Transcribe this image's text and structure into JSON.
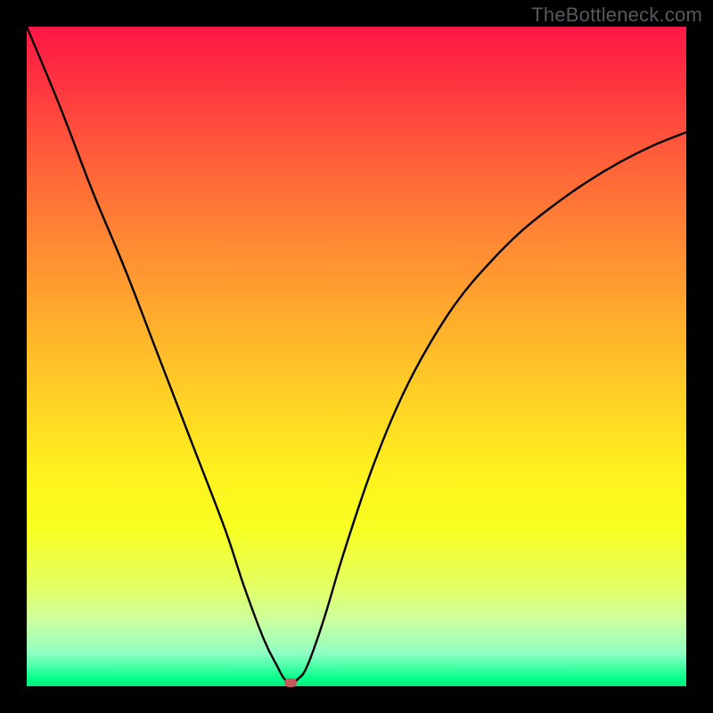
{
  "watermark": "TheBottleneck.com",
  "chart_data": {
    "type": "line",
    "title": "",
    "xlabel": "",
    "ylabel": "",
    "xlim": [
      0,
      100
    ],
    "ylim": [
      0,
      100
    ],
    "series": [
      {
        "name": "curve",
        "x": [
          0,
          5,
          10,
          15,
          20,
          25,
          30,
          33,
          36,
          38,
          39,
          40,
          41,
          42.5,
          45,
          48,
          52,
          56,
          60,
          65,
          70,
          75,
          80,
          85,
          90,
          95,
          100
        ],
        "y": [
          100,
          88,
          75,
          63,
          50,
          37,
          24,
          15,
          7,
          3,
          1.2,
          0.5,
          1,
          3,
          10,
          20,
          32,
          42,
          50,
          58,
          64,
          69,
          73,
          76.5,
          79.5,
          82,
          84
        ]
      }
    ],
    "marker": {
      "x": 40,
      "y": 0.5
    },
    "gradient_stops": [
      {
        "pos": 0,
        "color": "#ff1745"
      },
      {
        "pos": 50,
        "color": "#ffd624"
      },
      {
        "pos": 75,
        "color": "#fff21e"
      },
      {
        "pos": 100,
        "color": "#00e878"
      }
    ]
  }
}
